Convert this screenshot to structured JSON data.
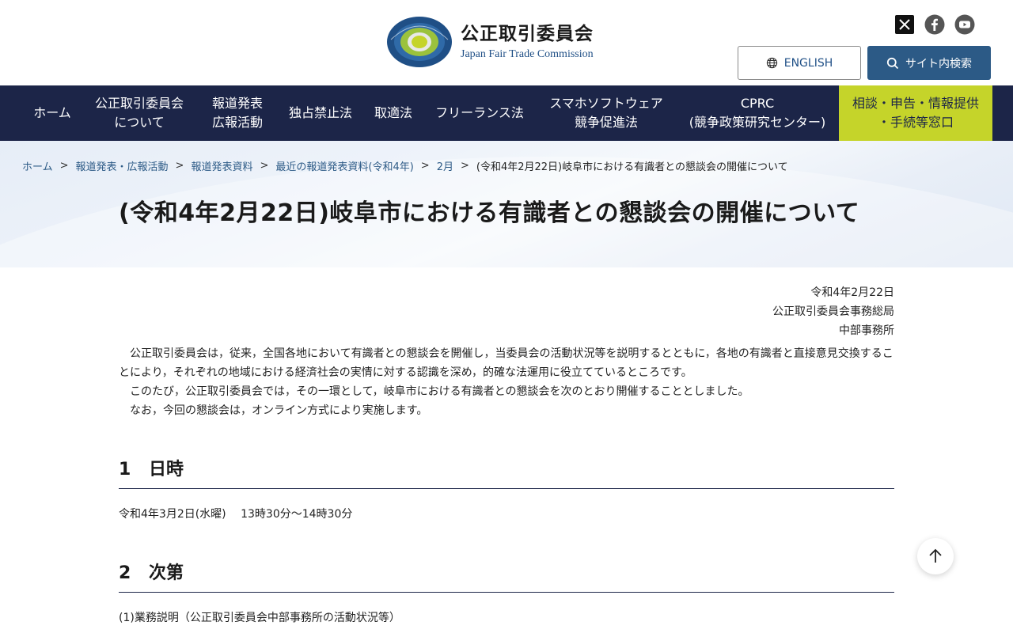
{
  "header": {
    "logo_ja": "公正取引委員会",
    "logo_en": "Japan Fair Trade Commission",
    "social": [
      "x-icon",
      "facebook-icon",
      "youtube-icon"
    ],
    "english_label": "ENGLISH",
    "search_label": "サイト内検索"
  },
  "nav": {
    "items": [
      {
        "label": "ホーム"
      },
      {
        "label": "公正取引委員会\nについて"
      },
      {
        "label": "報道発表\n広報活動"
      },
      {
        "label": "独占禁止法"
      },
      {
        "label": "取適法"
      },
      {
        "label": "フリーランス法"
      },
      {
        "label": "スマホソフトウェア\n競争促進法"
      },
      {
        "label": "CPRC\n(競争政策研究センター)"
      },
      {
        "label": "相談・申告・情報提供\n・手続等窓口"
      }
    ]
  },
  "breadcrumb": {
    "items": [
      "ホーム",
      "報道発表・広報活動",
      "報道発表資料",
      "最近の報道発表資料(令和4年)",
      "2月"
    ],
    "separator": ">",
    "current": "(令和4年2月22日)岐阜市における有識者との懇談会の開催について"
  },
  "page_title": "(令和4年2月22日)岐阜市における有識者との懇談会の開催について",
  "meta": {
    "date": "令和4年2月22日",
    "org": "公正取引委員会事務総局",
    "office": "中部事務所"
  },
  "paragraphs": [
    "公正取引委員会は，従来，全国各地において有識者との懇談会を開催し，当委員会の活動状況等を説明するとともに，各地の有識者と直接意見交換することにより，それぞれの地域における経済社会の実情に対する認識を深め，的確な法運用に役立てているところです。",
    "このたび，公正取引委員会では，その一環として，岐阜市における有識者との懇談会を次のとおり開催することとしました。",
    "なお，今回の懇談会は，オンライン方式により実施します。"
  ],
  "sections": [
    {
      "number": "1",
      "title": "日時",
      "body": "令和4年3月2日(水曜)　 13時30分～14時30分"
    },
    {
      "number": "2",
      "title": "次第",
      "body": "(1)業務説明（公正取引委員会中部事務所の活動状況等）"
    }
  ],
  "colors": {
    "nav_bg": "#1c2548",
    "accent_consult": "#c5d42a",
    "search_btn": "#2c5a86",
    "link": "#2c5a86"
  }
}
